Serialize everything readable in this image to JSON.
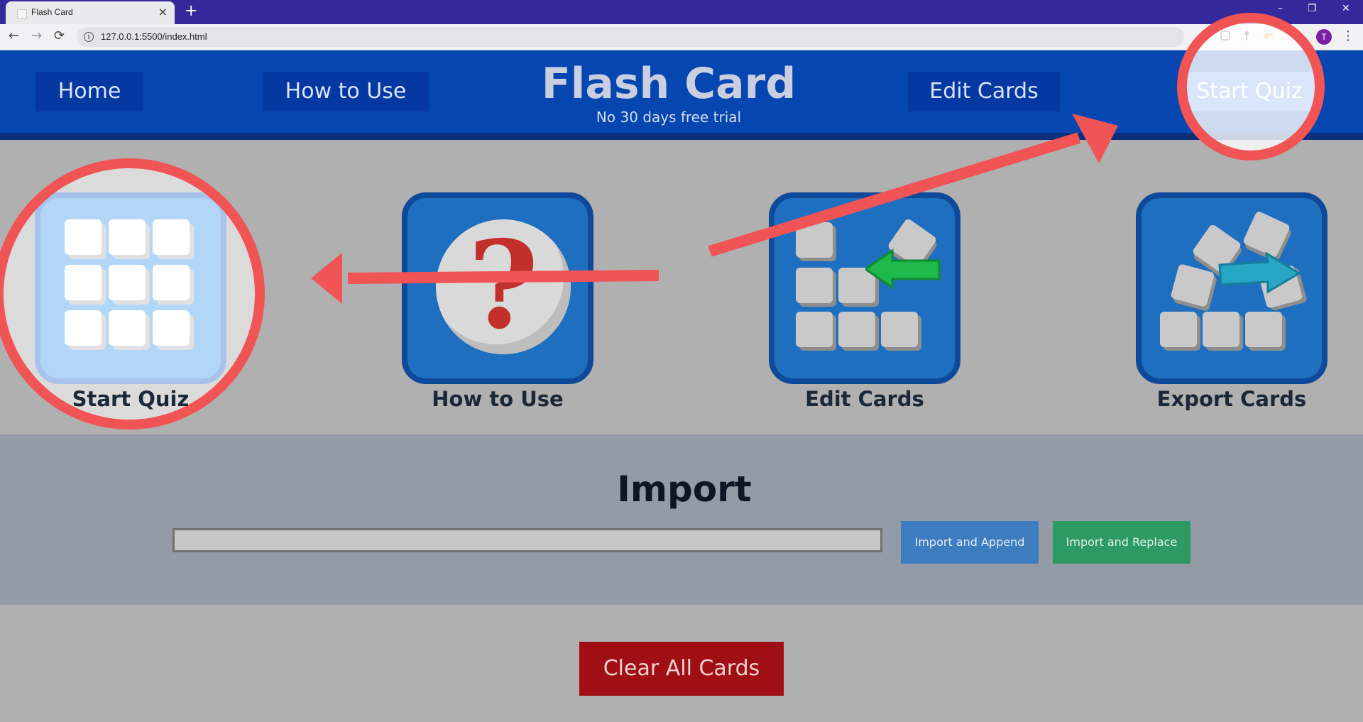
{
  "browser": {
    "tab_title": "Flash Card",
    "tab_close": "×",
    "new_tab": "+",
    "url": "127.0.0.1:5500/index.html",
    "profile_initial": "T",
    "window_controls": [
      "–",
      "❐",
      "✕"
    ]
  },
  "header": {
    "nav": {
      "home": "Home",
      "how_to_use": "How to Use",
      "edit_cards": "Edit Cards",
      "start_quiz": "Start Quiz"
    },
    "title": "Flash Card",
    "subtitle": "No 30 days free trial"
  },
  "tiles": [
    {
      "label": "Start Quiz",
      "icon": "grid-cards-icon"
    },
    {
      "label": "How to Use",
      "icon": "question-mark-icon"
    },
    {
      "label": "Edit Cards",
      "icon": "edit-cards-icon"
    },
    {
      "label": "Export Cards",
      "icon": "export-cards-icon"
    }
  ],
  "import": {
    "title": "Import",
    "input_value": "",
    "append_label": "Import and Append",
    "replace_label": "Import and Replace"
  },
  "clear_label": "Clear All Cards",
  "colors": {
    "header_blue": "#0646b0",
    "active_nav": "#3f7ee8",
    "annotation_red": "#f05455",
    "append_blue": "#3e7cc0",
    "replace_green": "#2e9a63",
    "clear_red": "#a00f14"
  }
}
